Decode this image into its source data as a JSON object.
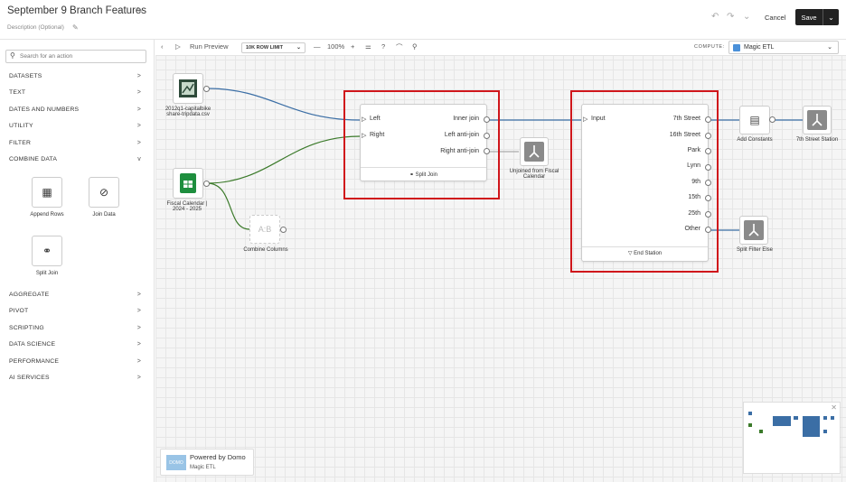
{
  "header": {
    "title": "September 9 Branch Features",
    "description_placeholder": "Description (Optional)",
    "cancel_label": "Cancel",
    "save_label": "Save"
  },
  "sidebar": {
    "search_placeholder": "Search for an action",
    "categories_top": [
      {
        "label": "DATASETS",
        "arrow": ">"
      },
      {
        "label": "TEXT",
        "arrow": ">"
      },
      {
        "label": "DATES AND NUMBERS",
        "arrow": ">"
      },
      {
        "label": "UTILITY",
        "arrow": ">"
      },
      {
        "label": "FILTER",
        "arrow": ">"
      },
      {
        "label": "COMBINE DATA",
        "arrow": "v"
      }
    ],
    "combine_tiles": [
      {
        "label": "Append Rows",
        "icon": "append-rows-icon"
      },
      {
        "label": "Join Data",
        "icon": "join-data-icon"
      },
      {
        "label": "Split Join",
        "icon": "split-join-icon"
      }
    ],
    "categories_bottom": [
      {
        "label": "AGGREGATE",
        "arrow": ">"
      },
      {
        "label": "PIVOT",
        "arrow": ">"
      },
      {
        "label": "SCRIPTING",
        "arrow": ">"
      },
      {
        "label": "DATA SCIENCE",
        "arrow": ">"
      },
      {
        "label": "PERFORMANCE",
        "arrow": ">"
      },
      {
        "label": "AI SERVICES",
        "arrow": ">"
      }
    ]
  },
  "toolbar": {
    "run_preview": "Run Preview",
    "row_limit": "10K ROW LIMIT",
    "zoom": "100%",
    "compute_label": "COMPUTE:",
    "compute_value": "Magic ETL"
  },
  "canvas": {
    "dataset1_label": "2012q1-capitalbikeshare-tripdata.csv",
    "dataset2_label": "Fiscal Calendar | 2024 - 2025",
    "combine_columns_label": "Combine Columns",
    "combine_columns_icon_text": "A:B",
    "split_join": {
      "inputs": [
        "Left",
        "Right"
      ],
      "outputs": [
        "Inner join",
        "Left anti-join",
        "Right anti-join"
      ],
      "footer": "Split Join"
    },
    "unjoined_label": "Unjoined from Fiscal Calendar",
    "end_station": {
      "input": "Input",
      "outputs": [
        "7th Street",
        "16th Street",
        "Park",
        "Lynn",
        "9th",
        "15th",
        "25th",
        "Other"
      ],
      "footer": "End Station"
    },
    "add_constants_label": "Add Constants",
    "seventh_street_station_label": "7th Street Station",
    "split_filter_else_label": "Split Filter Else"
  },
  "powered": {
    "logo_text": "DOMO",
    "line1": "Powered by Domo",
    "line2": "Magic ETL"
  },
  "colors": {
    "accent_blue": "#3b6ea5",
    "accent_green": "#3b7a2a",
    "highlight_red": "#d0161b"
  }
}
